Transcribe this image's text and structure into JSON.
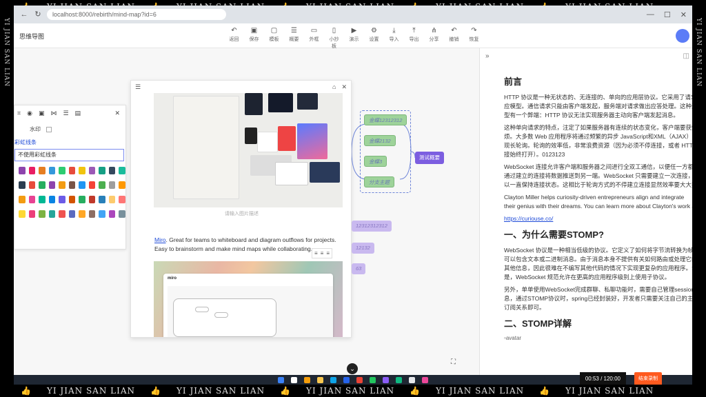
{
  "watermark": {
    "text": "YI JIAN SAN LIAN",
    "icon": "thumbs-up-icon"
  },
  "browser": {
    "url": "localhost:8000/rebirth/mind-map?id=6"
  },
  "app": {
    "title": "思维导图"
  },
  "toolbar": {
    "items": [
      {
        "label": "返回",
        "icon": "undo-icon"
      },
      {
        "label": "保存",
        "icon": "save-icon"
      },
      {
        "label": "模板",
        "icon": "template-icon"
      },
      {
        "label": "概要",
        "icon": "summary-icon"
      },
      {
        "label": "外框",
        "icon": "frame-icon"
      },
      {
        "label": "小抄板",
        "icon": "clipboard-icon"
      },
      {
        "label": "演示",
        "icon": "play-icon"
      },
      {
        "label": "设置",
        "icon": "settings-icon"
      },
      {
        "label": "导入",
        "icon": "import-icon"
      },
      {
        "label": "导出",
        "icon": "export-icon"
      },
      {
        "label": "分享",
        "icon": "share-icon"
      },
      {
        "label": "撤销",
        "icon": "undo-icon"
      },
      {
        "label": "恢复",
        "icon": "redo-icon"
      }
    ]
  },
  "style_panel": {
    "watermark_label": "水印",
    "rainbow_label": "彩虹线条",
    "rainbow_selected": "不使用彩虹线条",
    "swatch_rows": [
      [
        "#8e44ad",
        "#e91e63",
        "#e67e22",
        "#3498db",
        "#2ecc71",
        "#e74c3c",
        "#f1c40f",
        "#9b59b6",
        "#16a085",
        "#34495e",
        "#1abc9c"
      ],
      [
        "#2c3e50",
        "#e74c3c",
        "#27ae60",
        "#8e44ad",
        "#f39c12",
        "#795548",
        "#2196f3",
        "#f44336",
        "#4caf50",
        "#9e9e9e",
        "#ff9800"
      ],
      [
        "#f39c12",
        "#e84393",
        "#00b894",
        "#0984e3",
        "#6c5ce7",
        "#d35400",
        "#27ae60",
        "#c0392b",
        "#2980b9",
        "#fdcb6e",
        "#ff7675"
      ],
      [
        "#fdd835",
        "#ec407a",
        "#7cb342",
        "#26a69a",
        "#ef5350",
        "#5c6bc0",
        "#ffa726",
        "#8d6e63",
        "#42a5f5",
        "#ab47bc",
        "#78909c"
      ]
    ]
  },
  "doc": {
    "caption": "请输入图片描述",
    "miro_link": "Miro",
    "miro_text_1": ". Great for teams to whiteboard and diagram outflows for projects.",
    "miro_text_2": "Easy to brainstorm and make mind maps while collaborating."
  },
  "mindmap": {
    "root": "测试概要",
    "children": [
      "金蝶12312312",
      "金蝶2132",
      "金蝶3",
      "分支主题"
    ],
    "outer_nodes": [
      "12312312312",
      "12132",
      "63"
    ]
  },
  "article": {
    "heading": "前言",
    "p1": [
      "HTTP 协议是一种无状态的、无连接的、单向的应用层协议。它采用了请求/响应",
      "应模型。通信请求只能由客户端发起，服务端对请求做出应答处理。这种通信模",
      "型有一个弊端：HTTP 协议无法实现服务器主动向客户端发起消息。"
    ],
    "p2": [
      "这种单向请求的特点，注定了如果服务器有连续的状态变化，客户端要获知就非常麻",
      "烦。大多数 Web 应用程序将通过频繁的异步 JavaScript和XML（AJAX）请求实",
      "现长轮询。轮询的效率低，非常浪费资源（因为必须不停连接，或者 HTTP 连",
      "接始终打开）。0123123"
    ],
    "p3": [
      "WebSocket 连接允许客户端和服务器之间进行全双工通信，以便任一方都可以",
      "通过建立的连接将数据推送到另一端。WebSocket 只需要建立一次连接，就可",
      "以一直保持连接状态。这相比于轮询方式的不停建立连接显然效率要大大提高。"
    ],
    "p4": [
      "Clayton Miller helps curiosity-driven entrepreneurs align and integrate",
      "their genius with their dreams. You can learn more about Clayton's work at"
    ],
    "p4_link": "https://curiouse.co/",
    "h2_1": "一、为什么需要STOMP?",
    "p5": [
      "WebSocket 协议是一种相当低级的协议。它定义了如何将字节流转换为帧。帧",
      "可以包含文本或二进制消息。由于消息本身不提供有关如何路由或处理它的任何",
      "其他信息，因此很难在不编写其他代码的情况下实现更复杂的应用程序。幸运的",
      "是，WebSocket 规范允许在更高的应用程序级别上使用子协议。"
    ],
    "p6": [
      "另外，单单使用WebSocket完成群聊、私聊功能时，需要自己管理session信",
      "息，通过STOMP协议时，spring已经封装好，开发者只需要关注自己的主题、",
      "订阅关系即可。"
    ],
    "h2_2": "二、STOMP详解",
    "img_alt": "avatar"
  },
  "recorder": {
    "time": "00:53 / 120:00",
    "stop_label": "结束录制"
  },
  "taskbar_colors": [
    "#3b82f6",
    "#ffffff",
    "#f59e0b",
    "#f9c74f",
    "#0ea5e9",
    "#2563eb",
    "#ea4335",
    "#22c55e",
    "#8b5cf6",
    "#10b981",
    "#e5e7eb",
    "#ec4899"
  ]
}
